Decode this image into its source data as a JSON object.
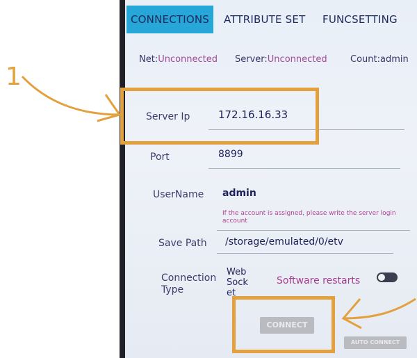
{
  "tabs": {
    "connections": "CONNECTIONS",
    "attribute_set": "ATTRIBUTE SET",
    "funcsetting": "FUNCSETTING"
  },
  "status": {
    "net_label": "Net:",
    "net_value": "Unconnected",
    "server_label": "Server:",
    "server_value": "Unconnected",
    "count": "Count:admin"
  },
  "fields": {
    "server_ip_label": "Server Ip",
    "server_ip_value": "172.16.16.33",
    "port_label": "Port",
    "port_value": "8899",
    "username_label": "UserName",
    "username_value": "admin",
    "username_hint": "If the account is assigned, please write the server login account",
    "save_path_label": "Save Path",
    "save_path_value": "/storage/emulated/0/etv",
    "connection_type_label": "Connection Type",
    "connection_type_value": "Web Sock et",
    "software_restarts_label": "Software restarts"
  },
  "buttons": {
    "connect": "CONNECT",
    "auto_connect": "AUTO CONNECT"
  },
  "annotation": {
    "marker": "1"
  },
  "colors": {
    "accent": "#e3a13e",
    "tab_active": "#27a6d8",
    "status_value": "#a14a9b"
  }
}
